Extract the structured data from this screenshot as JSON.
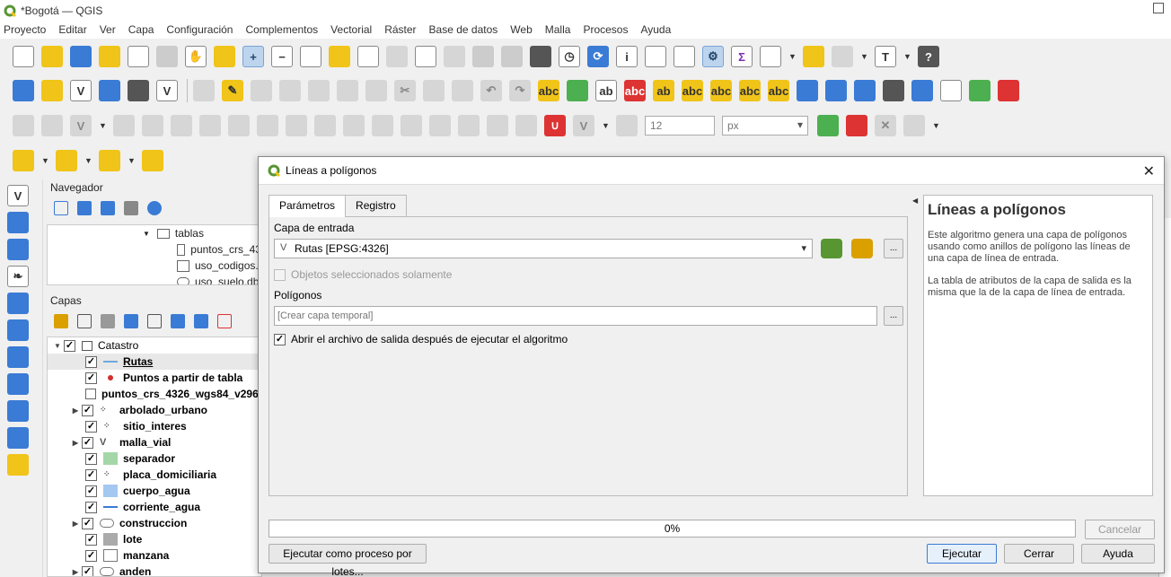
{
  "window": {
    "title": "*Bogotá — QGIS"
  },
  "menu": [
    "Proyecto",
    "Editar",
    "Ver",
    "Capa",
    "Configuración",
    "Complementos",
    "Vectorial",
    "Ráster",
    "Base de datos",
    "Web",
    "Malla",
    "Procesos",
    "Ayuda"
  ],
  "snapping": {
    "tolerance": "12",
    "unit": "px"
  },
  "browser": {
    "title": "Navegador",
    "items": [
      "tablas",
      "puntos_crs_43",
      "uso_codigos.",
      "uso_suelo.db"
    ]
  },
  "layers": {
    "title": "Capas",
    "group": "Catastro",
    "items": [
      {
        "label": "Rutas",
        "checked": "✓"
      },
      {
        "label": "Puntos a partir de tabla",
        "checked": "✓"
      },
      {
        "label": "puntos_crs_4326_wgs84_v296",
        "checked": ""
      },
      {
        "label": "arbolado_urbano",
        "checked": "✓"
      },
      {
        "label": "sitio_interes",
        "checked": "✓"
      },
      {
        "label": "malla_vial",
        "checked": "✓"
      },
      {
        "label": "separador",
        "checked": "✓"
      },
      {
        "label": "placa_domiciliaria",
        "checked": "✓"
      },
      {
        "label": "cuerpo_agua",
        "checked": "✓"
      },
      {
        "label": "corriente_agua",
        "checked": "✓"
      },
      {
        "label": "construccion",
        "checked": "✓"
      },
      {
        "label": "lote",
        "checked": "✓"
      },
      {
        "label": "manzana",
        "checked": "✓"
      },
      {
        "label": "anden",
        "checked": "✓"
      }
    ]
  },
  "dialog": {
    "title": "Líneas a polígonos",
    "tab_params": "Parámetros",
    "tab_log": "Registro",
    "input_label": "Capa de entrada",
    "input_value": "Rutas [EPSG:4326]",
    "browse": "...",
    "selected_only": "Objetos seleccionados solamente",
    "output_label": "Polígonos",
    "output_placeholder": "[Crear capa temporal]",
    "open_output": "Abrir el archivo de salida después de ejecutar el algoritmo",
    "open_output_check": "✓",
    "help_title": "Líneas a polígonos",
    "help_p1": "Este algoritmo genera una capa de polígonos usando como anillos de polígono las líneas de una capa de línea de entrada.",
    "help_p2": "La tabla de atributos de la capa de salida es la misma que la de la capa de línea de entrada.",
    "progress": "0%",
    "cancel": "Cancelar",
    "batch": "Ejecutar como proceso por lotes...",
    "run": "Ejecutar",
    "close": "Cerrar",
    "help": "Ayuda"
  },
  "colors": {
    "accent": "#3d7bd5",
    "qgis_green": "#589632",
    "route_line": "#6fa8dc",
    "point_red": "#d32f2f"
  }
}
